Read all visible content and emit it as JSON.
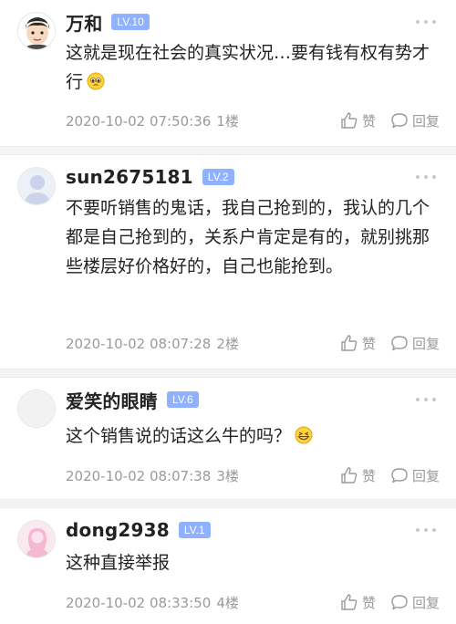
{
  "comments": [
    {
      "username": "万和",
      "level": "LV.10",
      "text": "这就是现在社会的真实状况…要有钱有权有势才行",
      "emoji": "pleading-face-emoji",
      "time": "2020-10-02 07:50:36",
      "floor": "1楼",
      "like_label": "赞",
      "reply_label": "回复",
      "avatar": "cartoon-man-avatar"
    },
    {
      "username": "sun2675181",
      "level": "LV.2",
      "text": "不要听销售的鬼话，我自己抢到的，我认的几个都是自己抢到的，关系户肯定是有的，就别挑那些楼层好价格好的，自己也能抢到。",
      "time": "2020-10-02 08:07:28",
      "floor": "2楼",
      "like_label": "赞",
      "reply_label": "回复",
      "avatar": "default-user-avatar"
    },
    {
      "username": "爱笑的眼睛",
      "level": "LV.6",
      "text": "这个销售说的话这么牛的吗？",
      "emoji": "grinning-face-emoji",
      "time": "2020-10-02 08:07:38",
      "floor": "3楼",
      "like_label": "赞",
      "reply_label": "回复",
      "avatar": "blank-avatar"
    },
    {
      "username": "dong2938",
      "level": "LV.1",
      "text": "这种直接举报",
      "time": "2020-10-02 08:33:50",
      "floor": "4楼",
      "like_label": "赞",
      "reply_label": "回复",
      "avatar": "pink-user-avatar"
    }
  ],
  "colors": {
    "level_badge": "#8fb1ff",
    "meta_text": "#9a9a9a",
    "divider": "#f4f4f4"
  }
}
